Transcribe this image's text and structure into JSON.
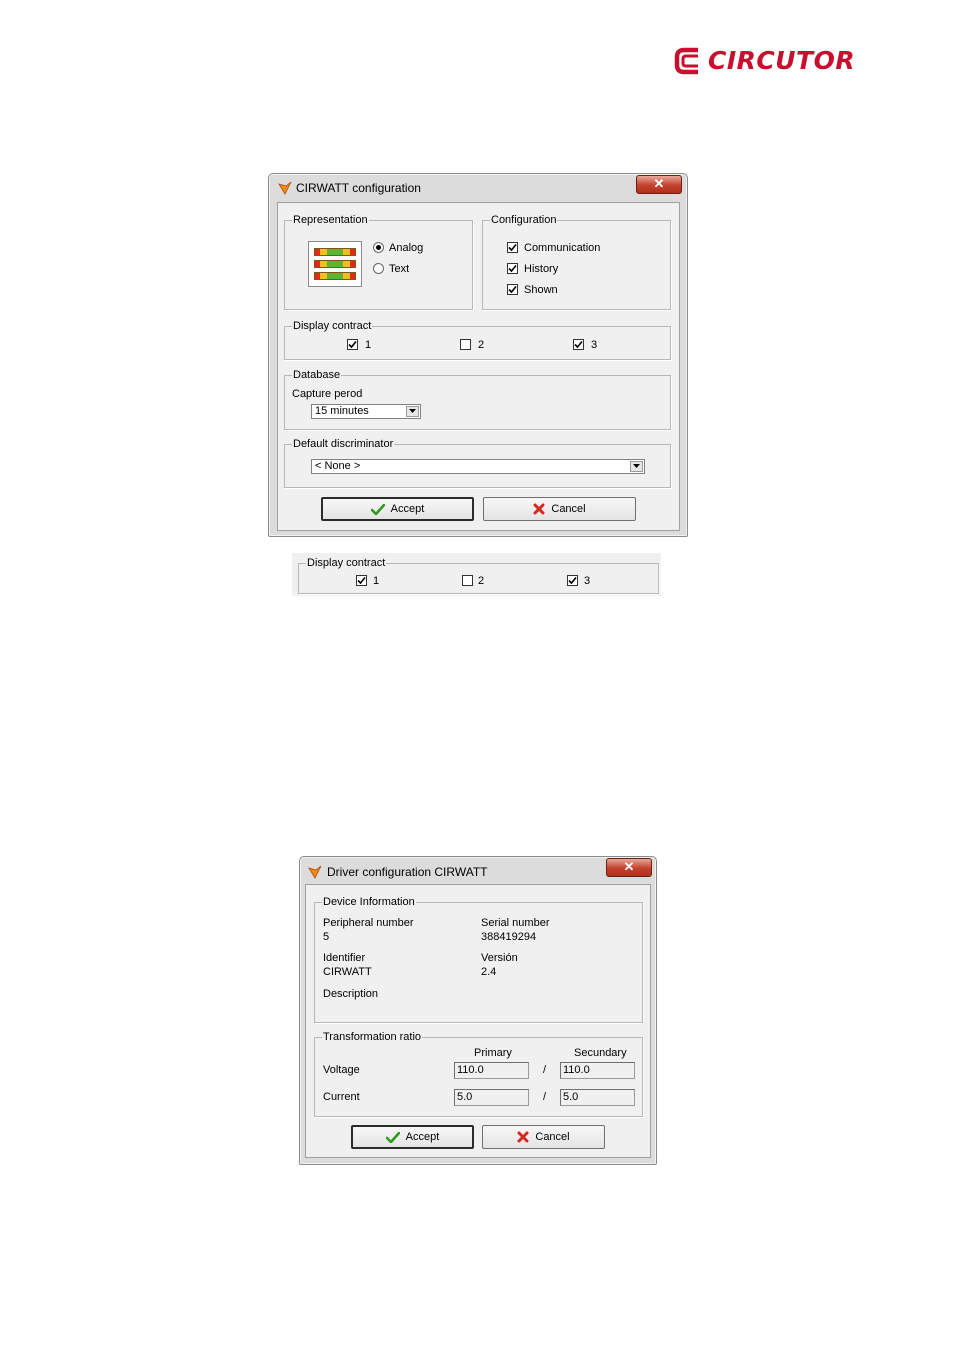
{
  "logo": {
    "text": "CIRCUTOR",
    "color": "#c8102e"
  },
  "dialog1": {
    "title": "CIRWATT configuration",
    "close_symbol": "✕",
    "representation": {
      "legend": "Representation",
      "options": [
        {
          "label": "Analog",
          "selected": true
        },
        {
          "label": "Text",
          "selected": false
        }
      ]
    },
    "configuration": {
      "legend": "Configuration",
      "items": [
        {
          "label": "Communication",
          "checked": true
        },
        {
          "label": "History",
          "checked": true
        },
        {
          "label": "Shown",
          "checked": true
        }
      ]
    },
    "display_contract": {
      "legend": "Display contract",
      "items": [
        {
          "label": "1",
          "checked": true
        },
        {
          "label": "2",
          "checked": false
        },
        {
          "label": "3",
          "checked": true
        }
      ]
    },
    "database": {
      "legend": "Database",
      "capture_label": "Capture perod",
      "capture_value": "15 minutes"
    },
    "discriminator": {
      "legend": "Default discriminator",
      "value": "< None >"
    },
    "accept_label": "Accept",
    "cancel_label": "Cancel"
  },
  "crop": {
    "legend": "Display contract",
    "items": [
      {
        "label": "1",
        "checked": true
      },
      {
        "label": "2",
        "checked": false
      },
      {
        "label": "3",
        "checked": true
      }
    ]
  },
  "dialog2": {
    "title": "Driver configuration CIRWATT",
    "close_symbol": "✕",
    "device_info": {
      "legend": "Device Information",
      "peripheral_label": "Peripheral number",
      "peripheral_value": "5",
      "serial_label": "Serial number",
      "serial_value": "388419294",
      "identifier_label": "Identifier",
      "identifier_value": "CIRWATT",
      "version_label": "Versión",
      "version_value": "2.4",
      "description_label": "Description"
    },
    "transformation": {
      "legend": "Transformation ratio",
      "primary_header": "Primary",
      "secondary_header": "Secundary",
      "separator": "/",
      "voltage_label": "Voltage",
      "voltage_primary": "110.0",
      "voltage_secondary": "110.0",
      "current_label": "Current",
      "current_primary": "5.0",
      "current_secondary": "5.0"
    },
    "accept_label": "Accept",
    "cancel_label": "Cancel"
  }
}
